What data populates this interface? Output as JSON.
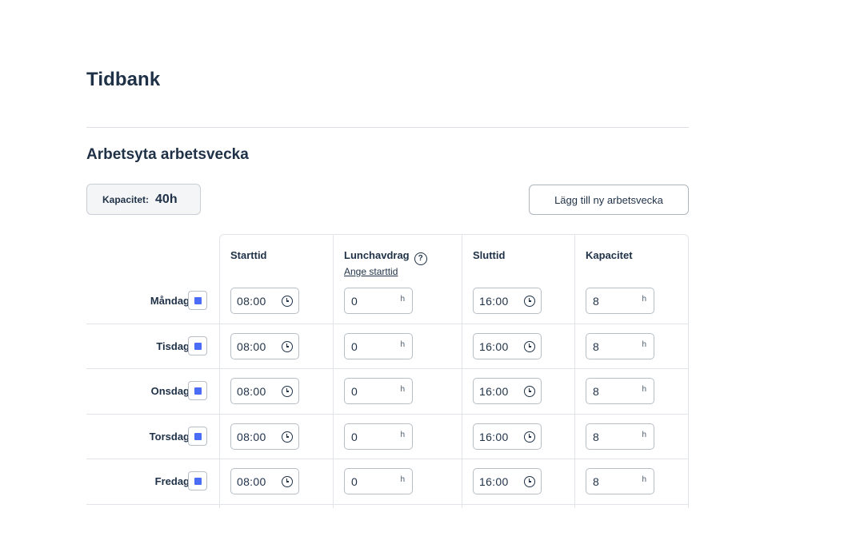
{
  "page": {
    "title": "Tidbank"
  },
  "section": {
    "title": "Arbetsyta arbetsvecka"
  },
  "capacity": {
    "label": "Kapacitet:",
    "value": "40h"
  },
  "actions": {
    "add_week": "Lägg till ny arbetsvecka"
  },
  "columns": {
    "start": "Starttid",
    "lunch": "Lunchavdrag",
    "lunch_help": "?",
    "lunch_link": "Ange starttid",
    "end": "Sluttid",
    "capacity": "Kapacitet"
  },
  "unit": "h",
  "accent_color": "#4a6cf7",
  "days": [
    {
      "name": "Måndag",
      "checked": true,
      "start": "08:00",
      "lunch": "0",
      "end": "16:00",
      "capacity": "8"
    },
    {
      "name": "Tisdag",
      "checked": true,
      "start": "08:00",
      "lunch": "0",
      "end": "16:00",
      "capacity": "8"
    },
    {
      "name": "Onsdag",
      "checked": true,
      "start": "08:00",
      "lunch": "0",
      "end": "16:00",
      "capacity": "8"
    },
    {
      "name": "Torsdag",
      "checked": true,
      "start": "08:00",
      "lunch": "0",
      "end": "16:00",
      "capacity": "8"
    },
    {
      "name": "Fredag",
      "checked": true,
      "start": "08:00",
      "lunch": "0",
      "end": "16:00",
      "capacity": "8"
    }
  ]
}
